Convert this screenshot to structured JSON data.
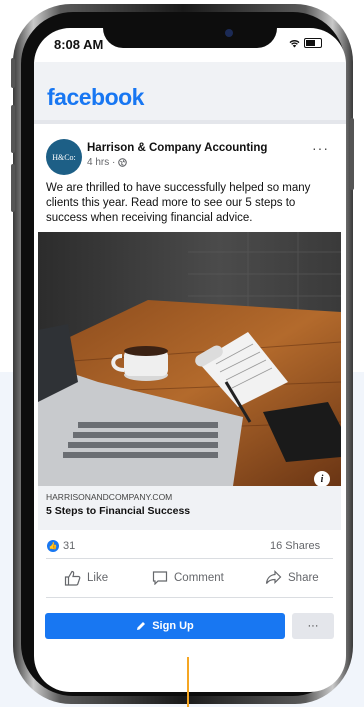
{
  "status_bar": {
    "time": "8:08 AM"
  },
  "app": {
    "logo": "facebook"
  },
  "post": {
    "avatar_text": "H&Co:",
    "page_name": "Harrison & Company Accounting",
    "meta": "4 hrs ·",
    "more_label": "···",
    "text": "We are thrilled to have successfully helped so many clients this year. Read more to see our 5 steps to success when receiving financial advice.",
    "info_label": "i",
    "link_domain": "HARRISONANDCOMPANY.COM",
    "link_title": "5 Steps to Financial Success"
  },
  "engagement": {
    "reaction_count": "31",
    "shares": "16 Shares"
  },
  "actions": {
    "like": "Like",
    "comment": "Comment",
    "share": "Share"
  },
  "cta": {
    "sign_up": "Sign Up",
    "more": "···"
  },
  "colors": {
    "brand": "#1877f2",
    "pointer": "#f5a623"
  },
  "icons": [
    "signal-icon",
    "wifi-icon",
    "battery-icon",
    "globe-icon",
    "more-icon",
    "info-icon",
    "like-icon",
    "comment-icon",
    "share-icon",
    "pencil-icon"
  ]
}
